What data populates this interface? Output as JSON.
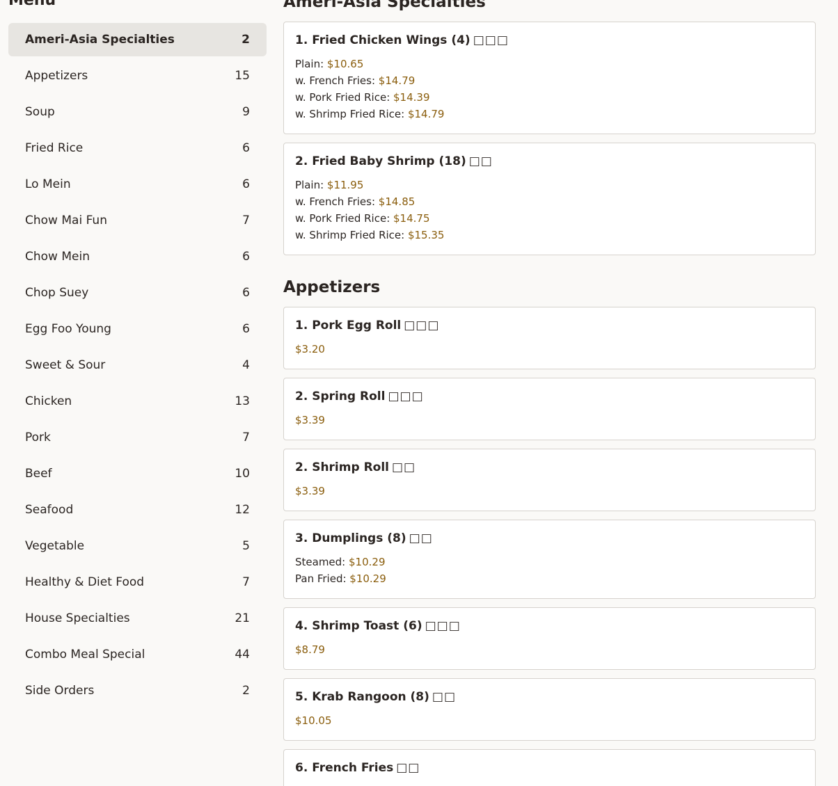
{
  "sidebar": {
    "title": "Menu",
    "categories": [
      {
        "label": "Ameri-Asia Specialties",
        "count": "2",
        "active": true
      },
      {
        "label": "Appetizers",
        "count": "15"
      },
      {
        "label": "Soup",
        "count": "9"
      },
      {
        "label": "Fried Rice",
        "count": "6"
      },
      {
        "label": "Lo Mein",
        "count": "6"
      },
      {
        "label": "Chow Mai Fun",
        "count": "7"
      },
      {
        "label": "Chow Mein",
        "count": "6"
      },
      {
        "label": "Chop Suey",
        "count": "6"
      },
      {
        "label": "Egg Foo Young",
        "count": "6"
      },
      {
        "label": "Sweet & Sour",
        "count": "4"
      },
      {
        "label": "Chicken",
        "count": "13"
      },
      {
        "label": "Pork",
        "count": "7"
      },
      {
        "label": "Beef",
        "count": "10"
      },
      {
        "label": "Seafood",
        "count": "12"
      },
      {
        "label": "Vegetable",
        "count": "5"
      },
      {
        "label": "Healthy & Diet Food",
        "count": "7"
      },
      {
        "label": "House Specialties",
        "count": "21"
      },
      {
        "label": "Combo Meal Special",
        "count": "44"
      },
      {
        "label": "Side Orders",
        "count": "2"
      }
    ]
  },
  "sections": [
    {
      "title": "Ameri-Asia Specialties",
      "items": [
        {
          "name": "1. Fried Chicken Wings (4)",
          "glyphs": "□□□",
          "prices": [
            {
              "label": "Plain: ",
              "price": "$10.65"
            },
            {
              "label": "w. French Fries: ",
              "price": "$14.79"
            },
            {
              "label": "w. Pork Fried Rice: ",
              "price": "$14.39"
            },
            {
              "label": "w. Shrimp Fried Rice: ",
              "price": "$14.79"
            }
          ]
        },
        {
          "name": "2. Fried Baby Shrimp (18)",
          "glyphs": "□□",
          "prices": [
            {
              "label": "Plain: ",
              "price": "$11.95"
            },
            {
              "label": "w. French Fries: ",
              "price": "$14.85"
            },
            {
              "label": "w. Pork Fried Rice: ",
              "price": "$14.75"
            },
            {
              "label": "w. Shrimp Fried Rice: ",
              "price": "$15.35"
            }
          ]
        }
      ]
    },
    {
      "title": "Appetizers",
      "items": [
        {
          "name": "1. Pork Egg Roll",
          "glyphs": "□□□",
          "prices": [
            {
              "label": "",
              "price": "$3.20"
            }
          ]
        },
        {
          "name": "2. Spring Roll",
          "glyphs": "□□□",
          "prices": [
            {
              "label": "",
              "price": "$3.39"
            }
          ]
        },
        {
          "name": "2. Shrimp Roll",
          "glyphs": "□□",
          "prices": [
            {
              "label": "",
              "price": "$3.39"
            }
          ]
        },
        {
          "name": "3. Dumplings (8)",
          "glyphs": "□□",
          "prices": [
            {
              "label": "Steamed: ",
              "price": "$10.29"
            },
            {
              "label": "Pan Fried: ",
              "price": "$10.29"
            }
          ]
        },
        {
          "name": "4. Shrimp Toast (6)",
          "glyphs": "□□□",
          "prices": [
            {
              "label": "",
              "price": "$8.79"
            }
          ]
        },
        {
          "name": "5. Krab Rangoon (8)",
          "glyphs": "□□",
          "prices": [
            {
              "label": "",
              "price": "$10.05"
            }
          ]
        },
        {
          "name": "6. French Fries",
          "glyphs": "□□",
          "prices": []
        }
      ]
    }
  ],
  "colors": {
    "price": "#8a5d0c",
    "active_bg": "#e7e5e1",
    "background": "#faf9f7"
  }
}
